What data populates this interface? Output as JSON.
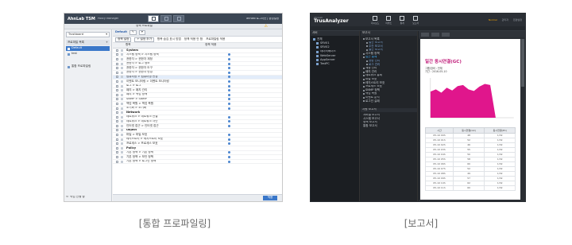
{
  "captions": {
    "left": "[통합 프로파일링]",
    "right": "[보고서]"
  },
  "tsm": {
    "logo": "AhnLab TSM",
    "logo_sub": "Policy Manager",
    "user_text": "ahnlab  로그아웃 | 환경설정",
    "sub_title": "정책 프로파일",
    "side_select": "Trustboard",
    "side_header": "프로파일 목록",
    "side_nodes": [
      "Default",
      "test"
    ],
    "side_foot": "통합 프로파일링",
    "side_bottom": "작업 진행 중",
    "main_head": "Default",
    "toolbar": [
      "정책 설정",
      "+ 설정 추가",
      "항목 숨김 표시 방법",
      "정책 적용 안 함",
      "프로파일링 적용"
    ],
    "cols": [
      "",
      "항목",
      "정책 적용"
    ],
    "rows": [
      {
        "name": "System",
        "group": true
      },
      {
        "name": "시스템 정책 > 시스템 정책",
        "group": false
      },
      {
        "name": "권한자 > 권한자 계정",
        "group": false
      },
      {
        "name": "권한자 > 로그 정보",
        "group": false
      },
      {
        "name": "권한자 > 권한자 도구",
        "group": false
      },
      {
        "name": "권한자 > 권한자 변경",
        "group": false
      },
      {
        "name": "컴퓨터명 > 컴퓨터명 변경",
        "group": false,
        "hl": true
      },
      {
        "name": "이벤트 모니터링 > 이벤트 모니터링",
        "group": false
      },
      {
        "name": "로그 > 로그",
        "group": false
      },
      {
        "name": "패치 > 패치 관리",
        "group": false
      },
      {
        "name": "패치 > 백업 정책",
        "group": false
      },
      {
        "name": "SNMP > SNMP",
        "group": false
      },
      {
        "name": "백업 복원 > 백업 복원",
        "group": false
      },
      {
        "name": "초기화 > 초기화",
        "group": false
      },
      {
        "name": "Network",
        "group": true
      },
      {
        "name": "네트워크 > 네트워크 연결",
        "group": false
      },
      {
        "name": "네트워크 > 네트워크 차단",
        "group": false
      },
      {
        "name": "인터넷 접근 > 인터넷 접근",
        "group": false
      },
      {
        "name": "Object",
        "group": true
      },
      {
        "name": "파일 > 파일 보호",
        "group": false
      },
      {
        "name": "레지스트리 > 레지스트리 보호",
        "group": false
      },
      {
        "name": "프로세스 > 프로세스 보호",
        "group": false
      },
      {
        "name": "Policy",
        "group": true
      },
      {
        "name": "기본 정책 > 기본 정책",
        "group": false
      },
      {
        "name": "기본 정책 > 보안 정책",
        "group": false
      },
      {
        "name": "기본 정책 > 로그인 정책",
        "group": false
      }
    ],
    "save_label": "적용"
  },
  "trus": {
    "logo": "TrusAnalyzer",
    "logo_sub": "AhnLab",
    "nav": [
      "대시보드",
      "이벤트",
      "통계",
      "보고서"
    ],
    "status": [
      "Normal",
      "관리자",
      "환경설정"
    ],
    "left_head": "서버",
    "tree": [
      "전체",
      "SRV01",
      "SRV02",
      "데이터베이스",
      "WebServer",
      "AppServer",
      "TestPC"
    ],
    "mid_head": "보고서",
    "mid_items": [
      {
        "t": "보고서 목록",
        "c": ""
      },
      {
        "t": "일간 보고서",
        "c": "sub"
      },
      {
        "t": "주간 보고서",
        "c": "sub"
      },
      {
        "t": "월간 보고서",
        "c": "sub"
      },
      {
        "t": "시스템 정책",
        "c": ""
      },
      {
        "t": "접근 통제",
        "c": "hl"
      },
      {
        "t": "권한 관리",
        "c": "sub"
      },
      {
        "t": "로그 관리",
        "c": "sub"
      },
      {
        "t": "계정 관리",
        "c": ""
      },
      {
        "t": "패치 관리",
        "c": ""
      },
      {
        "t": "네트워크 통제",
        "c": ""
      },
      {
        "t": "파일 보호",
        "c": ""
      },
      {
        "t": "레지스트리 보호",
        "c": ""
      },
      {
        "t": "프로세스 보호",
        "c": ""
      },
      {
        "t": "SNMP 정책",
        "c": ""
      },
      {
        "t": "백업 복원",
        "c": ""
      },
      {
        "t": "이벤트 분석",
        "c": ""
      },
      {
        "t": "로그인 실패",
        "c": ""
      }
    ],
    "mid_section": "자원 보고서",
    "mid_items2": [
      "서버별 보고서",
      "시스템 보고서",
      "정책 보고서",
      "통합 보고서"
    ],
    "doc_title": "일간 동시연결(GC)",
    "doc_meta": [
      "그룹/장비 : 전체",
      "기간 : 2016-05-10"
    ],
    "chart_series": [
      48,
      52,
      46,
      55,
      50,
      58,
      60,
      52,
      49,
      57,
      62,
      60,
      0,
      0,
      0,
      0
    ],
    "table_head": [
      "시간",
      "동시연결(GC)",
      "동시연결(PC)"
    ],
    "table_rows": [
      [
        "05-10 00h",
        "48",
        "1/32"
      ],
      [
        "05-10 01h",
        "52",
        "1/32"
      ],
      [
        "05-10 02h",
        "46",
        "1/32"
      ],
      [
        "05-10 03h",
        "55",
        "1/32"
      ],
      [
        "05-10 04h",
        "50",
        "1/32"
      ],
      [
        "05-10 05h",
        "58",
        "1/32"
      ],
      [
        "05-10 06h",
        "60",
        "1/32"
      ],
      [
        "05-10 07h",
        "52",
        "1/32"
      ],
      [
        "05-10 08h",
        "49",
        "1/32"
      ],
      [
        "05-10 09h",
        "57",
        "1/32"
      ],
      [
        "05-10 10h",
        "62",
        "1/32"
      ],
      [
        "05-10 11h",
        "60",
        "1/32"
      ]
    ]
  }
}
